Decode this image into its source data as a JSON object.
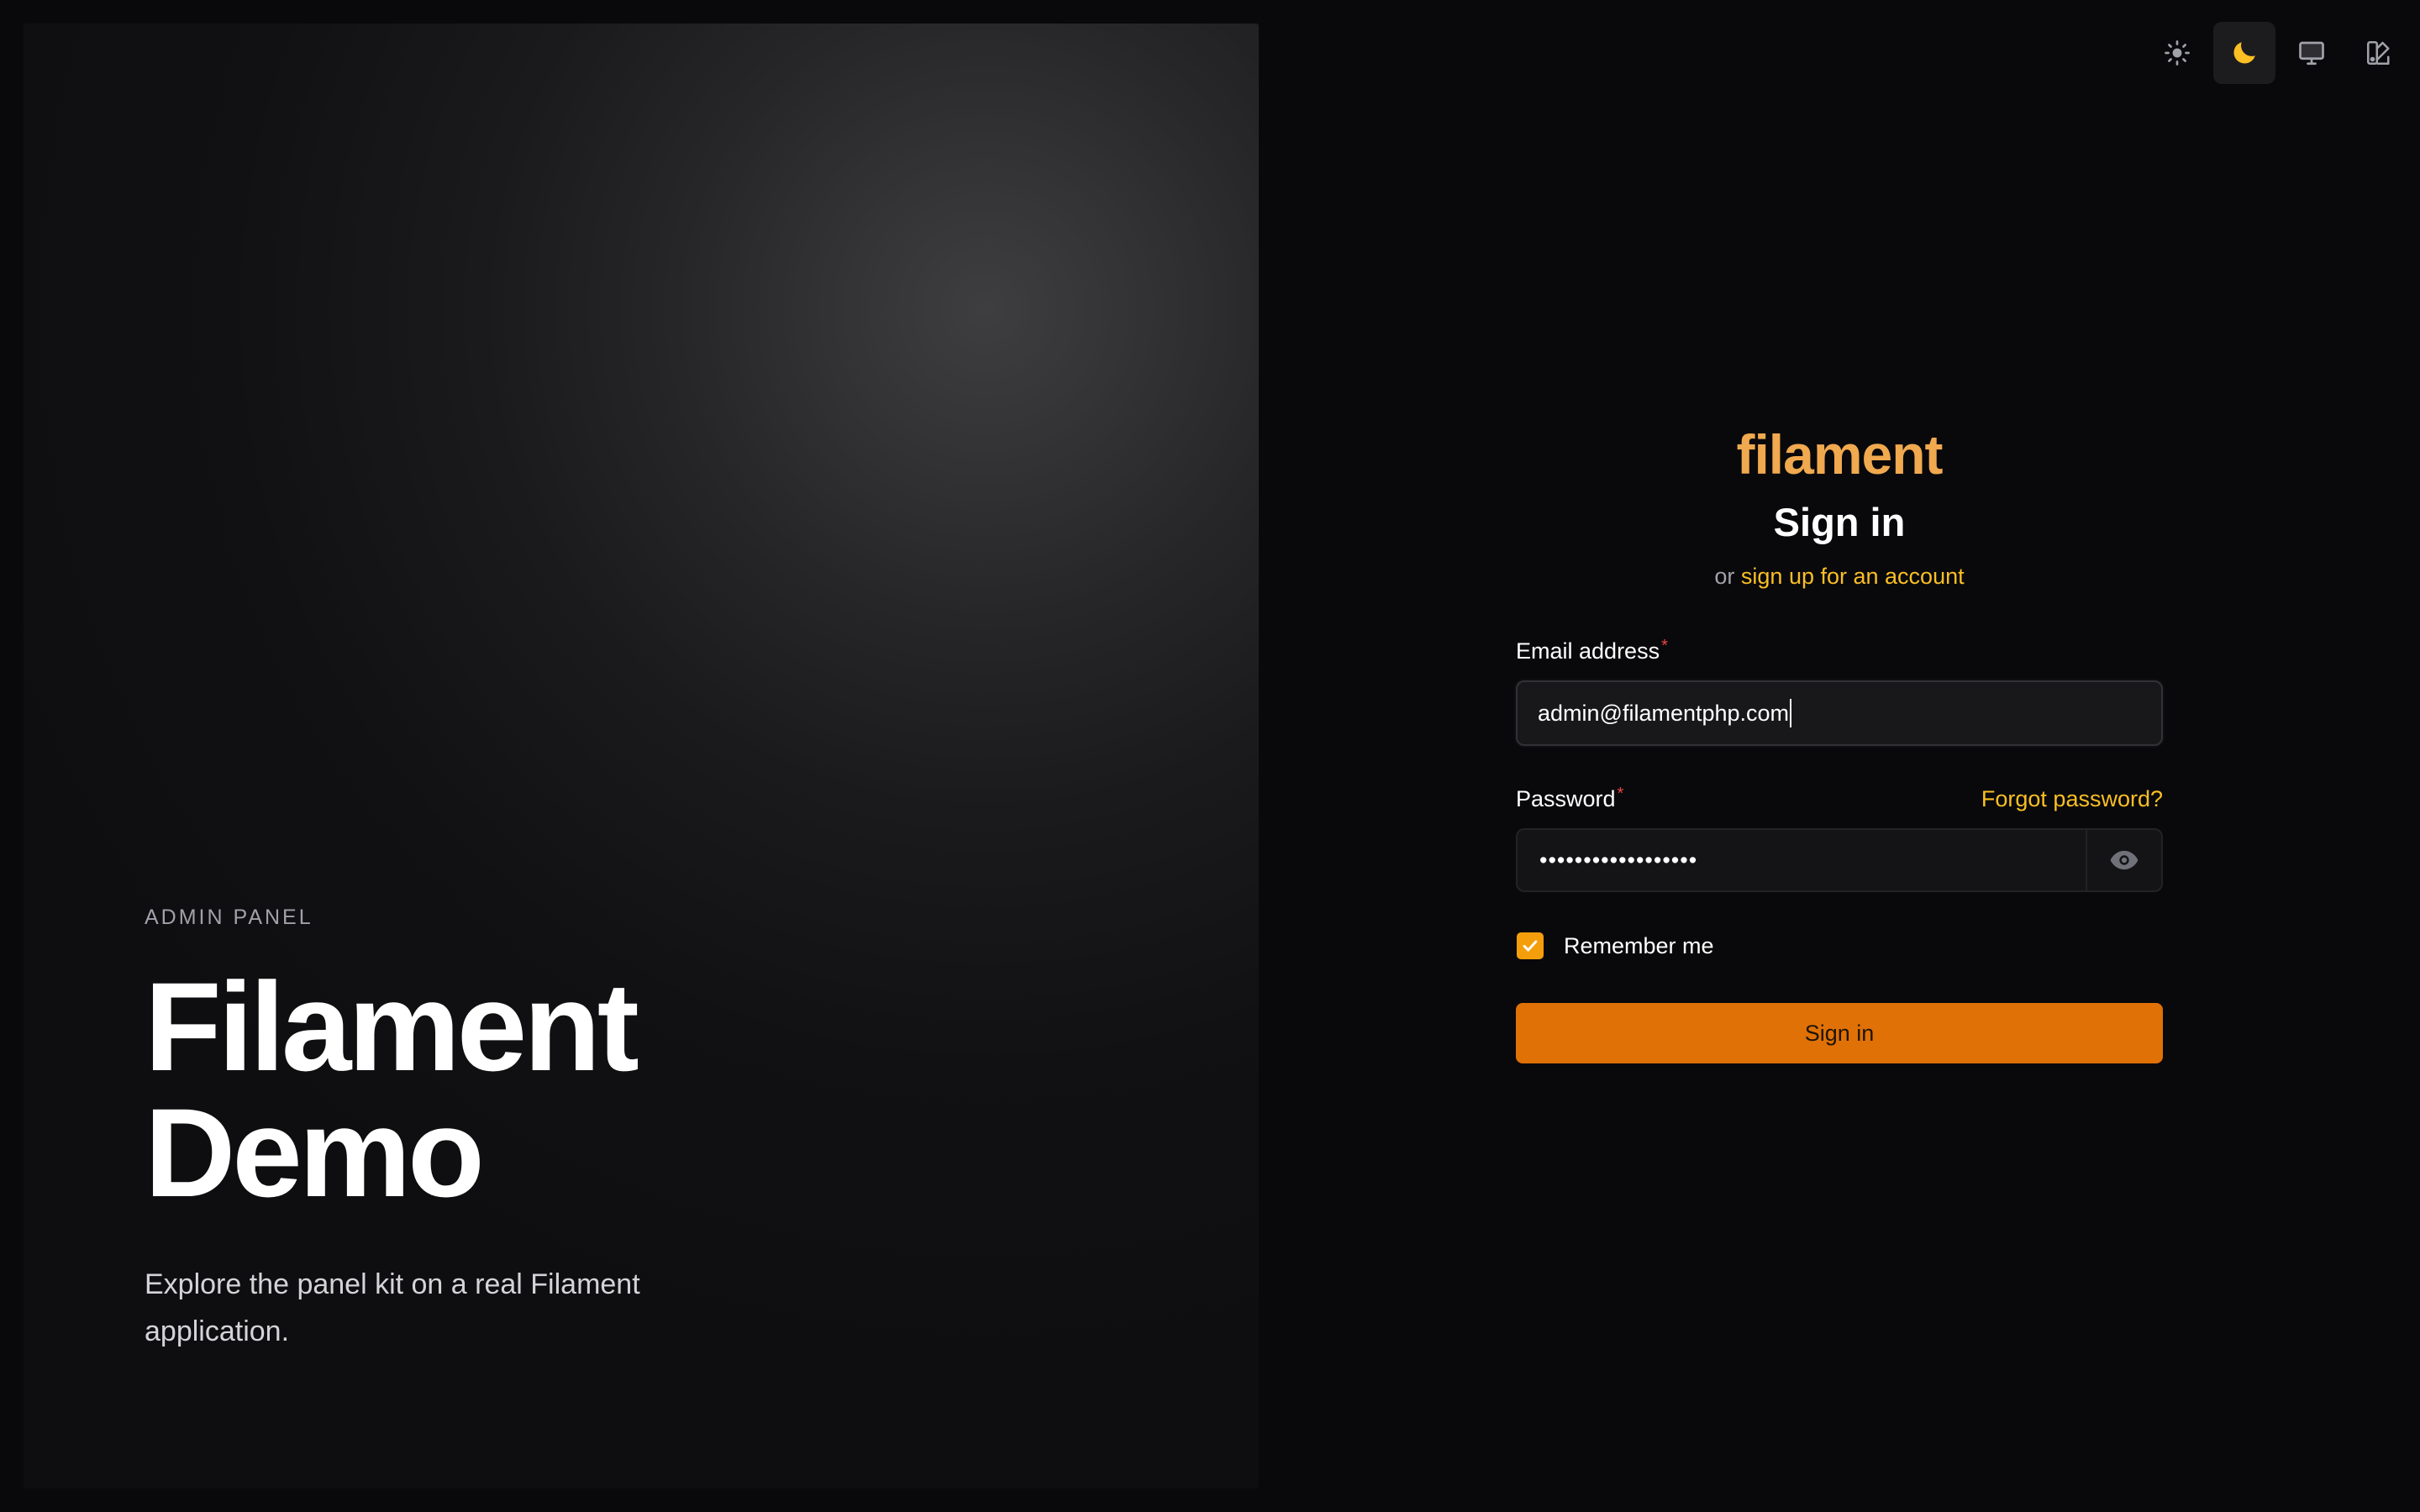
{
  "hero": {
    "eyebrow": "ADMIN PANEL",
    "title_line1": "Filament",
    "title_line2": "Demo",
    "description": "Explore the panel kit on a real Filament application."
  },
  "theme_switcher": {
    "options": [
      {
        "icon": "sun-icon",
        "active": false
      },
      {
        "icon": "moon-icon",
        "active": true
      },
      {
        "icon": "monitor-icon",
        "active": false
      },
      {
        "icon": "palette-icon",
        "active": false
      }
    ],
    "active_color": "#fbbf24"
  },
  "brand": {
    "logo_text": "filament",
    "color": "#f0a94f"
  },
  "form": {
    "heading": "Sign in",
    "subheading_prefix": "or",
    "signup_link": "sign up for an account",
    "email": {
      "label": "Email address",
      "value": "admin@filamentphp.com"
    },
    "password": {
      "label": "Password",
      "forgot_link": "Forgot password?",
      "masked_value": "••••••••••••••••••"
    },
    "remember_label": "Remember me",
    "remember_checked": true,
    "submit_label": "Sign in",
    "primary_color": "#e07106",
    "link_color": "#fbbf24"
  }
}
